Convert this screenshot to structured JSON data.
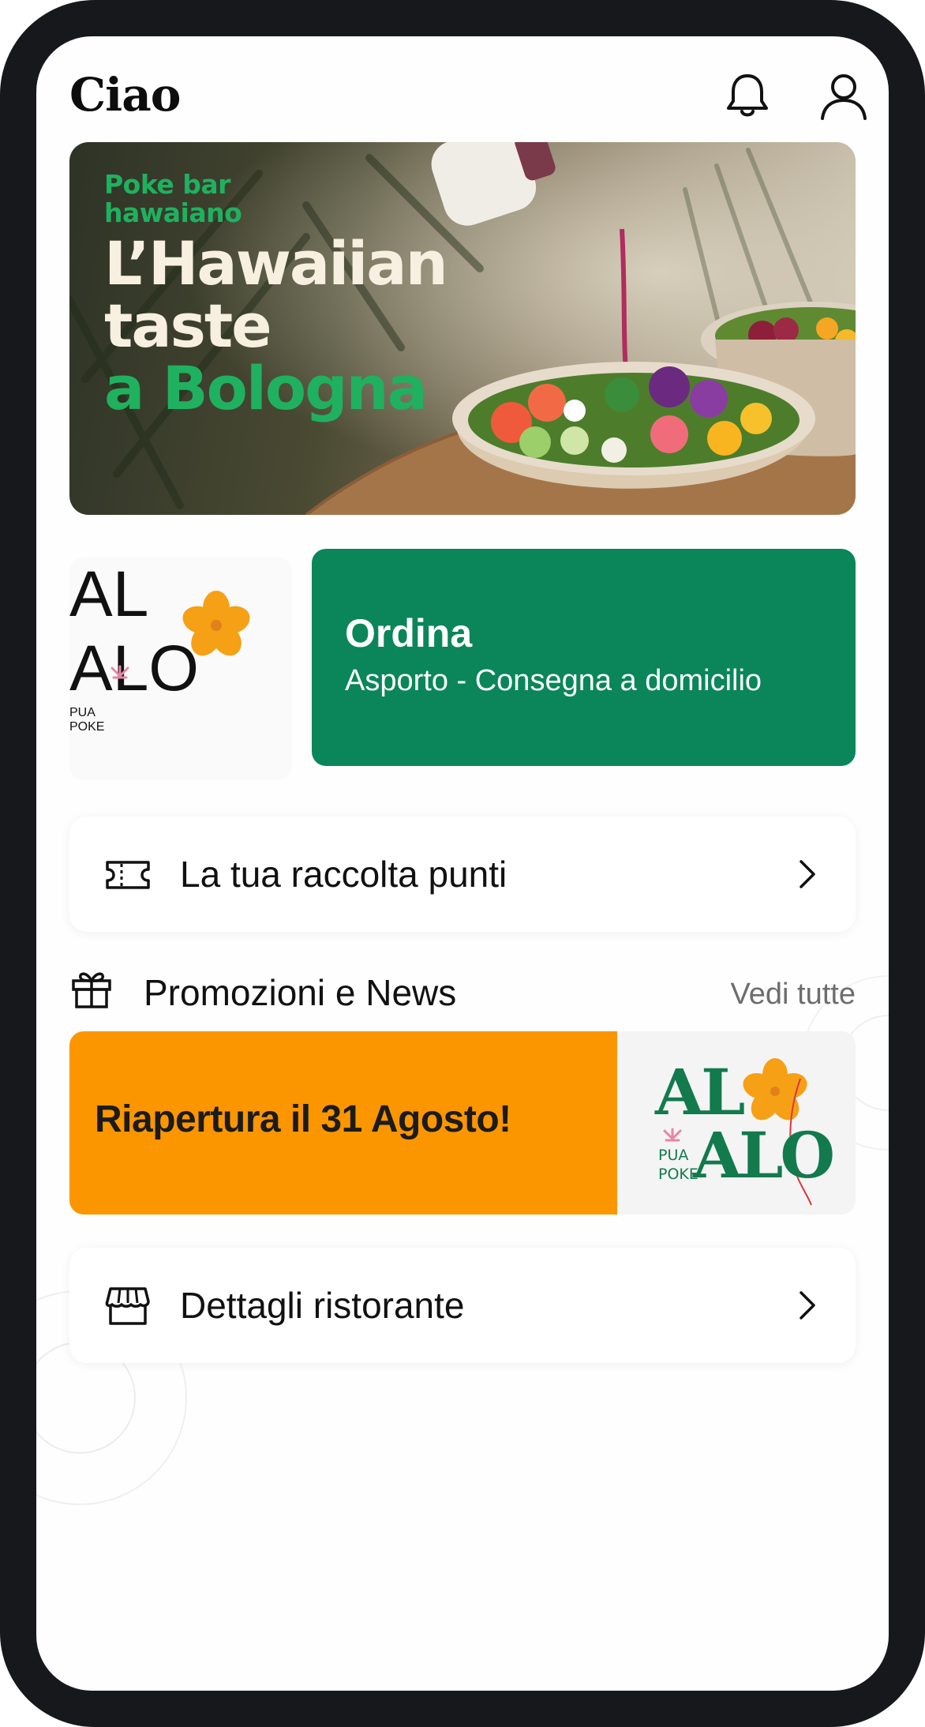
{
  "header": {
    "greeting": "Ciao",
    "icons": [
      "bell-icon",
      "user-icon"
    ]
  },
  "banner": {
    "tag": "Poke bar hawaiano",
    "title_line1": "L’Hawaiian",
    "title_line2": "taste",
    "title_line3": "a Bologna",
    "colors": {
      "accent": "#1fb15f",
      "title": "#f7efe0"
    }
  },
  "brand": {
    "logo_text_top": "AL",
    "logo_text_bottom": "ALO",
    "logo_small_1": "PUA",
    "logo_small_2": "POKE",
    "colors": {
      "green": "#127a4d",
      "orange": "#f6a015",
      "pink": "#e586a6"
    }
  },
  "order": {
    "title": "Ordina",
    "subtitle": "Asporto - Consegna a domicilio",
    "color": "#0a865a"
  },
  "points": {
    "label": "La tua raccolta punti",
    "icon": "ticket-icon"
  },
  "promotions": {
    "title": "Promozioni e News",
    "see_all": "Vedi tutte",
    "icon": "gift-icon",
    "items": [
      {
        "title": "Riapertura il 31 Agosto!",
        "color": "#fb9600"
      }
    ]
  },
  "restaurant": {
    "label": "Dettagli ristorante",
    "icon": "store-icon"
  }
}
